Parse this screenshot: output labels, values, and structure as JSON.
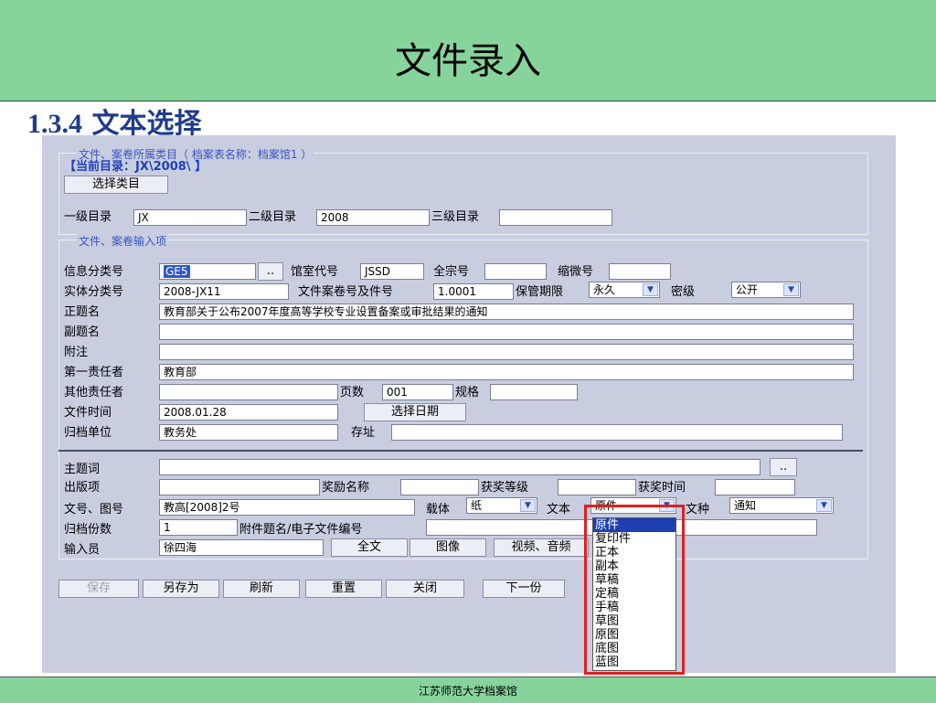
{
  "slide": {
    "title": "文件录入",
    "section_num": "1.3.4",
    "section_text": "文本选择",
    "footer": "江苏师范大学档案馆"
  },
  "form": {
    "group1_legend": "文件、案卷所属类目（ 档案表名称：档案馆1 ）",
    "current_dir": "【当前目录：JX\\2008\\ 】",
    "select_category_btn": "选择类目",
    "level1_label": "一级目录",
    "level1_value": "JX",
    "level2_label": "二级目录",
    "level2_value": "2008",
    "level3_label": "三级目录",
    "level3_value": "",
    "group2_legend": "文件、案卷输入项",
    "info_class_label": "信息分类号",
    "info_class_value": "GE5",
    "browse_btn": "..",
    "room_code_label": "馆室代号",
    "room_code_value": "JSSD",
    "fonds_label": "全宗号",
    "fonds_value": "",
    "micro_label": "缩微号",
    "micro_value": "",
    "entity_class_label": "实体分类号",
    "entity_class_value": "2008-JX11",
    "file_no_label": "文件案卷号及件号",
    "file_no_value": "1.0001",
    "retention_label": "保管期限",
    "retention_value": "永久",
    "secrecy_label": "密级",
    "secrecy_value": "公开",
    "title_label": "正题名",
    "title_value": "教育部关于公布2007年度高等学校专业设置备案或审批结果的通知",
    "subtitle_label": "副题名",
    "subtitle_value": "",
    "note_label": "附注",
    "note_value": "",
    "first_resp_label": "第一责任者",
    "first_resp_value": "教育部",
    "other_resp_label": "其他责任者",
    "other_resp_value": "",
    "pages_label": "页数",
    "pages_value": "001",
    "spec_label": "规格",
    "spec_value": "",
    "file_time_label": "文件时间",
    "file_time_value": "2008.01.28",
    "select_date_btn": "选择日期",
    "archive_unit_label": "归档单位",
    "archive_unit_value": "教务处",
    "location_label": "存址",
    "location_value": "",
    "subject_label": "主题词",
    "subject_value": "",
    "publish_label": "出版项",
    "publish_value": "",
    "award_name_label": "奖励名称",
    "award_name_value": "",
    "award_level_label": "获奖等级",
    "award_level_value": "",
    "award_time_label": "获奖时间",
    "award_time_value": "",
    "doc_no_label": "文号、图号",
    "doc_no_value": "教高[2008]2号",
    "carrier_label": "载体",
    "carrier_value": "纸",
    "text_label": "文本",
    "text_value": "原件",
    "doc_type_label": "文种",
    "doc_type_value": "通知",
    "copies_label": "归档份数",
    "copies_value": "1",
    "attach_label": "附件题名/电子文件编号",
    "attach_value": "",
    "inputter_label": "输入员",
    "inputter_value": "徐四海",
    "fulltext_btn": "全文",
    "image_btn": "图像",
    "video_btn": "视频、音频"
  },
  "actions": {
    "save": "保存",
    "save_as": "另存为",
    "refresh": "刷新",
    "reset": "重置",
    "close": "关闭",
    "next": "下一份"
  },
  "dropdown": {
    "options": [
      "原件",
      "复印件",
      "正本",
      "副本",
      "草稿",
      "定稿",
      "手稿",
      "草图",
      "原图",
      "底图",
      "蓝图"
    ],
    "selected": "原件"
  },
  "colors": {
    "header_bg": "#86d49c",
    "section_title": "#1f3c8c",
    "form_bg": "#c8cde0",
    "highlight_box": "#e02020",
    "selected_option": "#1d3fb0"
  }
}
